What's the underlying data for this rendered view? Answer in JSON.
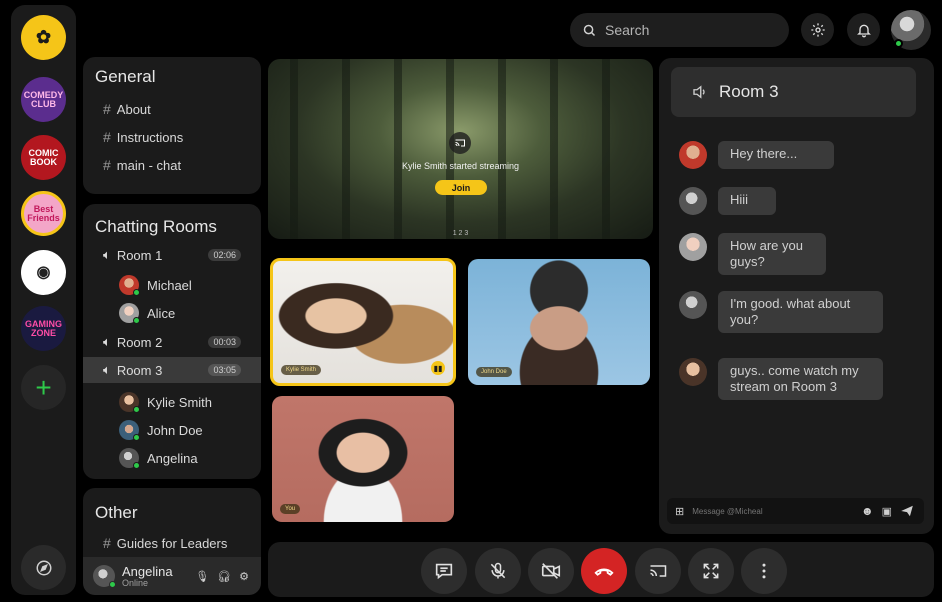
{
  "search": {
    "placeholder": "Search"
  },
  "servers": [
    {
      "label": "COMEDY CLUB",
      "color": "#5b2d8e"
    },
    {
      "label": "COMIC BOOK",
      "color": "#b3171f"
    },
    {
      "label": "Best Friends",
      "color": "#f3a6c8"
    },
    {
      "label": "",
      "color": "#ffffff"
    },
    {
      "label": "GAMING ZONE",
      "color": "#1a1a40"
    }
  ],
  "general": {
    "title": "General",
    "channels": [
      "About",
      "Instructions",
      "main - chat"
    ]
  },
  "chatting_rooms": {
    "title": "Chatting Rooms",
    "rooms": [
      {
        "name": "Room 1",
        "timer": "02:06",
        "members": [
          "Michael",
          "Alice"
        ]
      },
      {
        "name": "Room 2",
        "timer": "00:03",
        "members": []
      },
      {
        "name": "Room 3",
        "timer": "03:05",
        "members": [
          "Kylie Smith",
          "John Doe",
          "Angelina"
        ]
      }
    ]
  },
  "other": {
    "title": "Other",
    "channels": [
      "Guides for Leaders"
    ]
  },
  "current_user": {
    "name": "Angelina",
    "status": "Online"
  },
  "stream": {
    "message": "Kylie Smith started streaming",
    "join_label": "Join",
    "page_counter": "1 2 3"
  },
  "participants": [
    {
      "name": "Kylie Smith",
      "speaking": true
    },
    {
      "name": "John Doe",
      "speaking": false
    },
    {
      "name": "You",
      "speaking": false
    }
  ],
  "chat": {
    "room_title": "Room 3",
    "messages": [
      {
        "text": "Hey there..."
      },
      {
        "text": "Hiii"
      },
      {
        "text": "How are you guys?"
      },
      {
        "text": "I'm good. what about you?"
      },
      {
        "text": "guys.. come watch my stream on Room 3"
      }
    ],
    "composer_placeholder": "Message @Micheal"
  },
  "colors": {
    "accent": "#f5c518",
    "online": "#2ec94a",
    "end_call": "#d42424"
  }
}
